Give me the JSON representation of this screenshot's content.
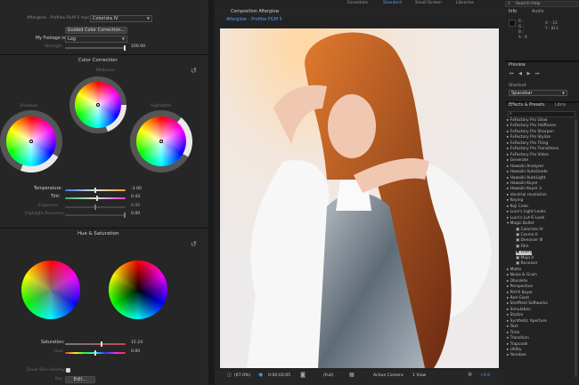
{
  "topbar": {
    "tabs": [
      "Essentials",
      "Standard",
      "Small Screen",
      "Libraries"
    ],
    "active_tab": "Standard",
    "search_placeholder": "Search Help"
  },
  "effect_controls": {
    "lut_label": "Afterglow - Profiles FILM 5 mpc",
    "lut_value": "Colorista IV",
    "guided_button": "Guided Color Correction...",
    "footage_label": "My Footage is:",
    "footage_value": "Log",
    "strength_label": "Strength",
    "strength_value": "100.00",
    "color_correction_title": "Color Correction",
    "midtones": "Midtones",
    "shadows": "Shadows",
    "highlights": "Highlights",
    "temperature_label": "Temperature:",
    "temperature_value": "-3.00",
    "tint_label": "Tint:",
    "tint_value": "0.43",
    "exposure_label": "Exposure:",
    "exposure_value": "0.00",
    "highlight_recovery_label": "Highlight Recovery:",
    "highlight_recovery_value": "0.00",
    "hue_sat_title": "Hue & Saturation",
    "saturation_label": "Saturation:",
    "saturation_value": "15.24",
    "hue_label": "Hue:",
    "hue_value": "0.00",
    "skin_overlay_label": "Show Skin Overlay",
    "key_label": "Key",
    "edit_button": "Edit..."
  },
  "composition": {
    "panel_title": "Composition Afterglow",
    "comp_name": "Afterglow – Profiles FILM 5",
    "zoom": "(67.0%)",
    "timecode": "0:00:03:05",
    "resolution": "(Full)",
    "camera": "Active Camera",
    "views": "1 View",
    "exposure": "+0.0"
  },
  "info": {
    "tab": "Info",
    "audio_tab": "Audio",
    "r": "R :",
    "g": "G :",
    "b": "B :",
    "a": "A : 0",
    "x": "X : -12",
    "y": "Y : 813"
  },
  "preview": {
    "title": "Preview"
  },
  "shortcut": {
    "label": "Shortcut",
    "value": "Spacebar"
  },
  "effects": {
    "title": "Effects & Presets",
    "libs_tab": "Libra",
    "items": [
      "FxFactory Pro Glow",
      "FxFactory Pro Halftones",
      "FxFactory Pro Sharpen",
      "FxFactory Pro Stylize",
      "FxFactory Pro Tiling",
      "FxFactory Pro Transitions",
      "FxFactory Pro Video",
      "Generate",
      "Hawaiki Analyzer",
      "Hawaiki AutoGrade",
      "Hawaiki AutoLight",
      "Hawaiki Keyer",
      "Hawaiki Keyer 3",
      "idustrial revolution",
      "Keying",
      "Koji Color",
      "Luca's Light Leaks",
      "Luca's Lut-Fi Look",
      "Magic Bullet"
    ],
    "sub_items": [
      "Colorista IV",
      "Cosmo II",
      "Denoiser III",
      "Film",
      "Looks",
      "Mojo II",
      "Renoiser"
    ],
    "selected_sub": "Looks",
    "items_after": [
      "Matte",
      "Noise & Grain",
      "Obsolete",
      "Perspective",
      "PHYX Keyer",
      "Red Giant",
      "Sheffield Softworks",
      "Simulation",
      "Stylize",
      "Synthetic Aperture",
      "Text",
      "Time",
      "Transition",
      "Trapcode",
      "Utility",
      "Yanobox"
    ]
  }
}
